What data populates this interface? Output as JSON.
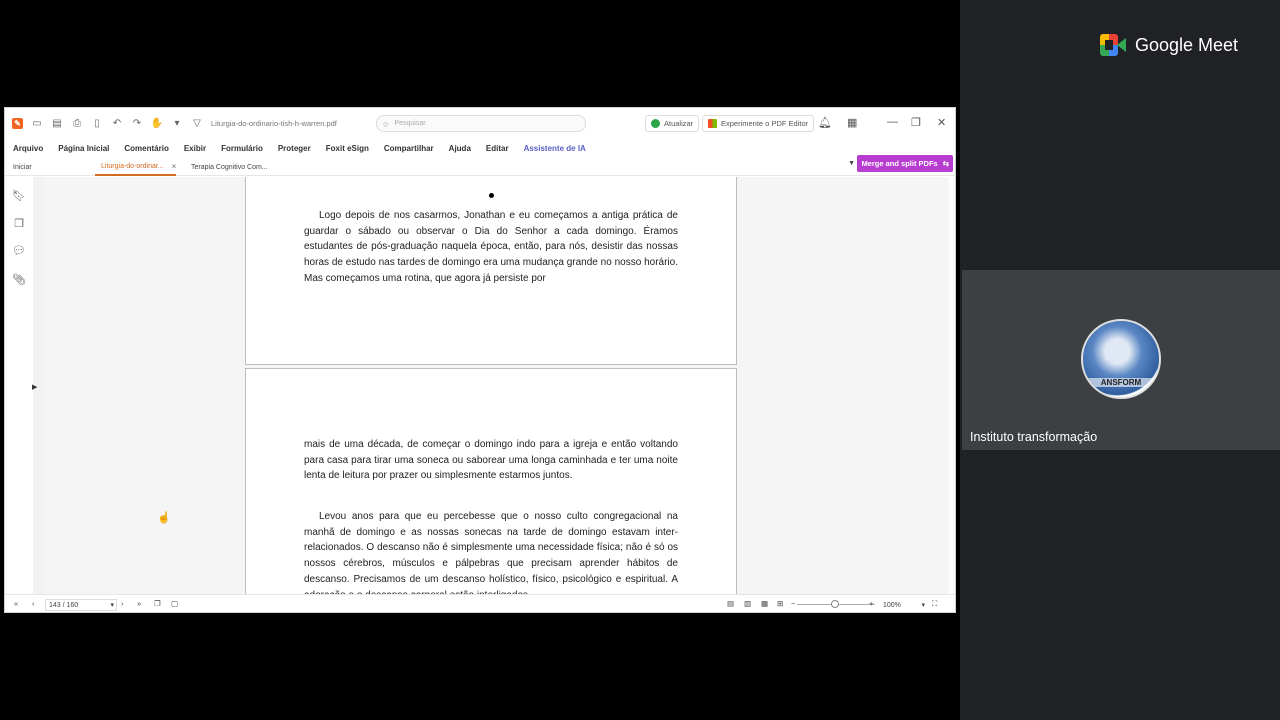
{
  "app": {
    "filename": "Liturgia-do-ordinario-tish-h-warren.pdf",
    "search_placeholder": "Pesquisar",
    "update_label": "Atualizar",
    "try_editor_label": "Experimente o PDF Editor"
  },
  "menu": [
    "Arquivo",
    "Página Inicial",
    "Comentário",
    "Exibir",
    "Formulário",
    "Proteger",
    "Foxit eSign",
    "Compartilhar",
    "Ajuda",
    "Editar",
    "Assistente de IA"
  ],
  "tabs": [
    {
      "label": "Iniciar"
    },
    {
      "label": "Liturgia-do-ordinar..."
    },
    {
      "label": "Terapia Cognitivo Com..."
    }
  ],
  "merge_button": "Merge and split PDFs",
  "document": {
    "page1_paragraph": "Logo depois de nos casarmos, Jonathan e eu começamos a antiga prática de guardar o sábado ou observar o Dia do Senhor a cada domingo. Éramos estudantes de pós-graduação naquela época, então, para nós, desistir das nossas horas de estudo nas tardes de domingo era uma mudança grande no nosso horário. Mas começamos uma rotina, que agora já persiste por",
    "page2_paragraph1": "mais de uma década, de começar o domingo indo para a igreja e então voltando para casa para tirar uma soneca ou saborear uma longa caminhada e ter uma noite lenta de leitura por prazer ou simplesmente estarmos juntos.",
    "page2_paragraph2": "Levou anos para que eu percebesse que o nosso culto congregacional na manhã de domingo e as nossas sonecas na tarde de domingo estavam inter-relacionados. O descanso não é simplesmente uma necessidade física; não é só os nossos cérebros, músculos e pálpebras que precisam aprender hábitos de descanso. Precisamos de um descanso holístico, físico, psicológico e espiritual. A adoração e o descanso corporal estão interligados."
  },
  "status": {
    "page_indicator": "143 / 160",
    "zoom": "100%"
  },
  "meet": {
    "brand": "Google Meet",
    "participant_name": "Instituto transformação",
    "avatar_text": "ANSFORM"
  }
}
